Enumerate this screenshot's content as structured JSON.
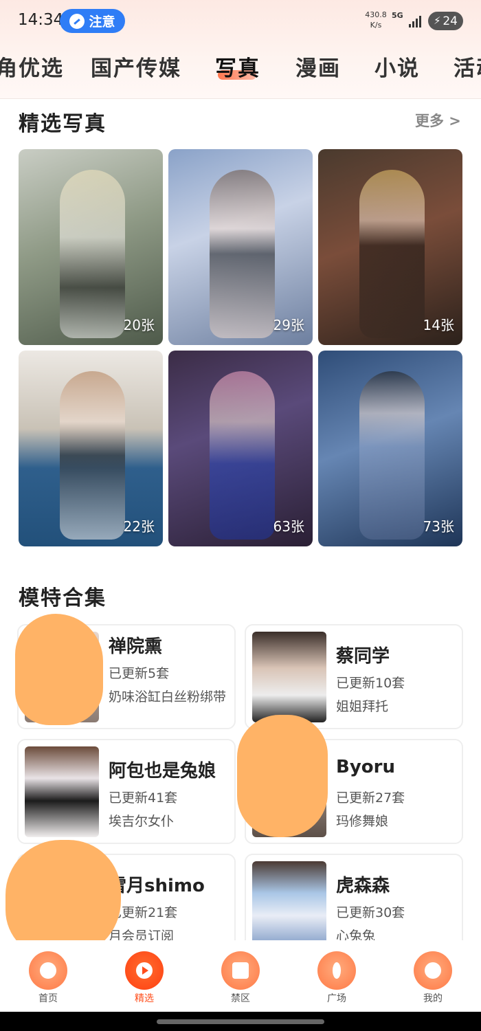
{
  "status_bar": {
    "time": "14:34",
    "notice_label": "注意",
    "net_speed_value": "430.8",
    "net_speed_unit": "K/s",
    "network": "5G",
    "battery": "24"
  },
  "tabs": [
    {
      "label": "角优选"
    },
    {
      "label": "国产传媒"
    },
    {
      "label": "写真"
    },
    {
      "label": "漫画"
    },
    {
      "label": "小说"
    },
    {
      "label": "活动"
    }
  ],
  "featured": {
    "title": "精选写真",
    "more_label": "更多 >",
    "photos": [
      {
        "count": "20张"
      },
      {
        "count": "29张"
      },
      {
        "count": "14张"
      },
      {
        "count": "22张"
      },
      {
        "count": "63张"
      },
      {
        "count": "73张"
      }
    ]
  },
  "models": {
    "title": "模特合集",
    "items": [
      {
        "name": "禅院熏",
        "updated": "已更新5套",
        "desc": "奶味浴缸白丝粉绑带"
      },
      {
        "name": "蔡同学",
        "updated": "已更新10套",
        "desc": "姐姐拜托"
      },
      {
        "name": "阿包也是兔娘",
        "updated": "已更新41套",
        "desc": "埃吉尔女仆"
      },
      {
        "name": "Byoru",
        "updated": "已更新27套",
        "desc": "玛修舞娘"
      },
      {
        "name": "雪月shimo",
        "updated": "已更新21套",
        "desc": "月会员订阅"
      },
      {
        "name": "虎森森",
        "updated": "已更新30套",
        "desc": "心兔兔"
      }
    ]
  },
  "bottom_nav": [
    {
      "label": "首页",
      "icon": "star-icon"
    },
    {
      "label": "精选",
      "icon": "play-icon"
    },
    {
      "label": "禁区",
      "icon": "lock-icon"
    },
    {
      "label": "广场",
      "icon": "compass-icon"
    },
    {
      "label": "我的",
      "icon": "smile-icon"
    }
  ],
  "colors": {
    "accent": "#ff4d1a",
    "notice_pill": "#2f7df6",
    "nav_icon": "#ff8856",
    "redaction": "#ffb366"
  }
}
